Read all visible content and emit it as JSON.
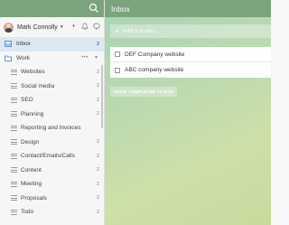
{
  "header": {
    "title": "Inbox"
  },
  "user": {
    "name": "Mark Connolly"
  },
  "inbox": {
    "label": "Inbox",
    "count": "2"
  },
  "work": {
    "label": "Work",
    "dots": "•••"
  },
  "sidebar": {
    "items": [
      {
        "label": "Websites",
        "count": "2"
      },
      {
        "label": "Social media",
        "count": "2"
      },
      {
        "label": "SEO",
        "count": "2"
      },
      {
        "label": "Planning",
        "count": "2"
      },
      {
        "label": "Reporting and Invoices",
        "count": ""
      },
      {
        "label": "Design",
        "count": "2"
      },
      {
        "label": "Contact/Emails/Calls",
        "count": "2"
      },
      {
        "label": "Content",
        "count": "2"
      },
      {
        "label": "Meeting",
        "count": "2"
      },
      {
        "label": "Proposals",
        "count": "2"
      },
      {
        "label": "Todo",
        "count": "2"
      }
    ]
  },
  "add_todo": {
    "placeholder": "Add a to-do..."
  },
  "todos": [
    {
      "text": "DEF Company website"
    },
    {
      "text": "ABC company website"
    }
  ],
  "show_completed": {
    "label": "SHOW COMPLETED TO-DOS"
  },
  "colors": {
    "header": "#7aa37e",
    "selected": "#dce9f5"
  }
}
